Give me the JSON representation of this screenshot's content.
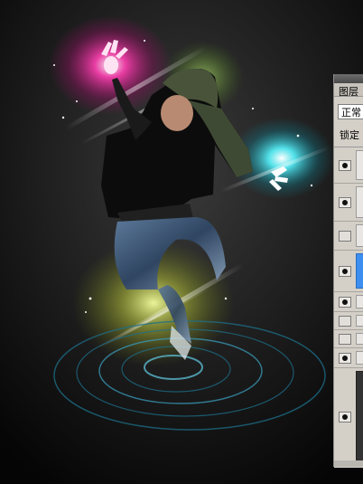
{
  "layers_panel": {
    "tab_label": "图层",
    "blend_mode": "正常",
    "lock_label": "锁定",
    "layers": [
      {
        "visible": true,
        "thumb": "plain"
      },
      {
        "visible": true,
        "thumb": "plain"
      },
      {
        "visible": false,
        "thumb": "plain"
      },
      {
        "visible": true,
        "thumb": "blue"
      },
      {
        "visible": true,
        "thumb": "plain"
      },
      {
        "visible": false,
        "thumb": "plain"
      },
      {
        "visible": false,
        "thumb": "plain"
      },
      {
        "visible": true,
        "thumb": "plain"
      },
      {
        "visible": true,
        "thumb": "dark"
      }
    ]
  },
  "colors": {
    "background": "#111111",
    "magenta_glow": "#ff2aa0",
    "cyan_glow": "#36f0ff",
    "yellow_glow": "#d7e05a",
    "panel": "#d4d0c8",
    "selected_layer": "#3d8ef0"
  },
  "icons": [
    "eye-icon"
  ]
}
